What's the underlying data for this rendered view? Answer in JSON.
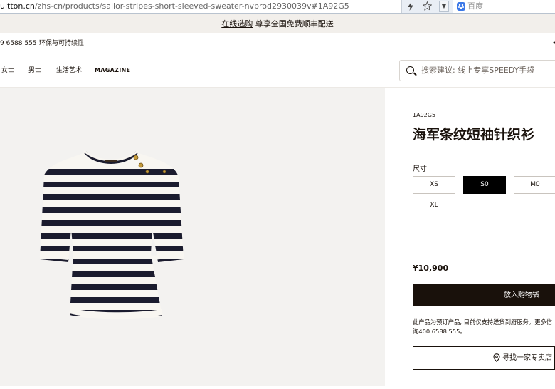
{
  "browser": {
    "url_host": "uitton.cn",
    "url_path": "/zhs-cn/products/sailor-stripes-short-sleeved-sweater-nvprod2930039v#1A92G5",
    "search_engine_label": "百度",
    "icons": [
      "lightning-icon",
      "star-icon",
      "chevron-down-icon",
      "baidu-icon"
    ]
  },
  "promo": {
    "link_text": "在线选购",
    "message": " 尊享全国免费顺丰配送"
  },
  "utility": {
    "phone": "9 6588 555",
    "eco": "环保与可持续性"
  },
  "nav": {
    "items": [
      {
        "label": "女士"
      },
      {
        "label": "男士"
      },
      {
        "label": "生活艺术"
      },
      {
        "label": "MAGAZINE"
      }
    ],
    "search_placeholder": "搜索建议: 线上专享SPEEDY手袋"
  },
  "product": {
    "sku": "1A92G5",
    "title": "海军条纹短袖针织衫",
    "size_label": "尺寸",
    "sizes": [
      {
        "label": "XS",
        "selected": false
      },
      {
        "label": "S0",
        "selected": true
      },
      {
        "label": "M0",
        "selected": false
      },
      {
        "label": "XL",
        "selected": false
      }
    ],
    "price": "¥10,900",
    "add_to_cart": "放入购物袋",
    "notice_line1": "此产品为预订产品, 目前仅支持送货到府服务。更多信",
    "notice_line2": "询400 6588 555。",
    "find_store": "寻找一家专卖店"
  },
  "colors": {
    "dark": "#19110b",
    "promo_bg": "#f2efeb",
    "image_bg": "#f3f2f0",
    "stripe": "#1b1c2e",
    "knit": "#f8f6f1"
  }
}
